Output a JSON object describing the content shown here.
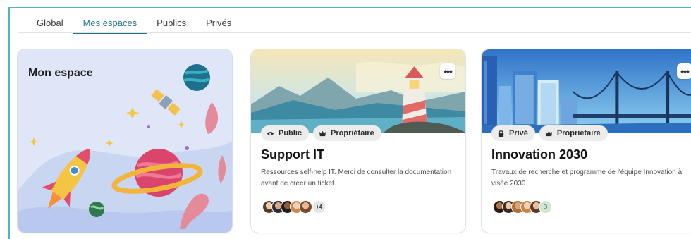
{
  "tabs": [
    {
      "label": "Global",
      "active": false
    },
    {
      "label": "Mes espaces",
      "active": true
    },
    {
      "label": "Publics",
      "active": false
    },
    {
      "label": "Privés",
      "active": false
    }
  ],
  "mine_card": {
    "title": "Mon espace"
  },
  "spaces": [
    {
      "title": "Support IT",
      "visibility": "Public",
      "visibility_icon": "eye-icon",
      "role": "Propriétaire",
      "role_icon": "crown-icon",
      "description": "Ressources self-help IT. Merci de consulter la documentation avant de créer un ticket.",
      "more_label": "•••",
      "members_more": "+4"
    },
    {
      "title": "Innovation 2030",
      "visibility": "Privé",
      "visibility_icon": "lock-icon",
      "role": "Propriétaire",
      "role_icon": "crown-icon",
      "description": "Travaux de recherche et programme de l'équipe Innovation à visée 2030",
      "more_label": "•••",
      "member_initial": "D"
    }
  ],
  "colors": {
    "accent": "#1c6f86",
    "frame": "#4fb3c2",
    "badge_bg": "#ececec",
    "mine_bg": "#dfe6f8"
  }
}
